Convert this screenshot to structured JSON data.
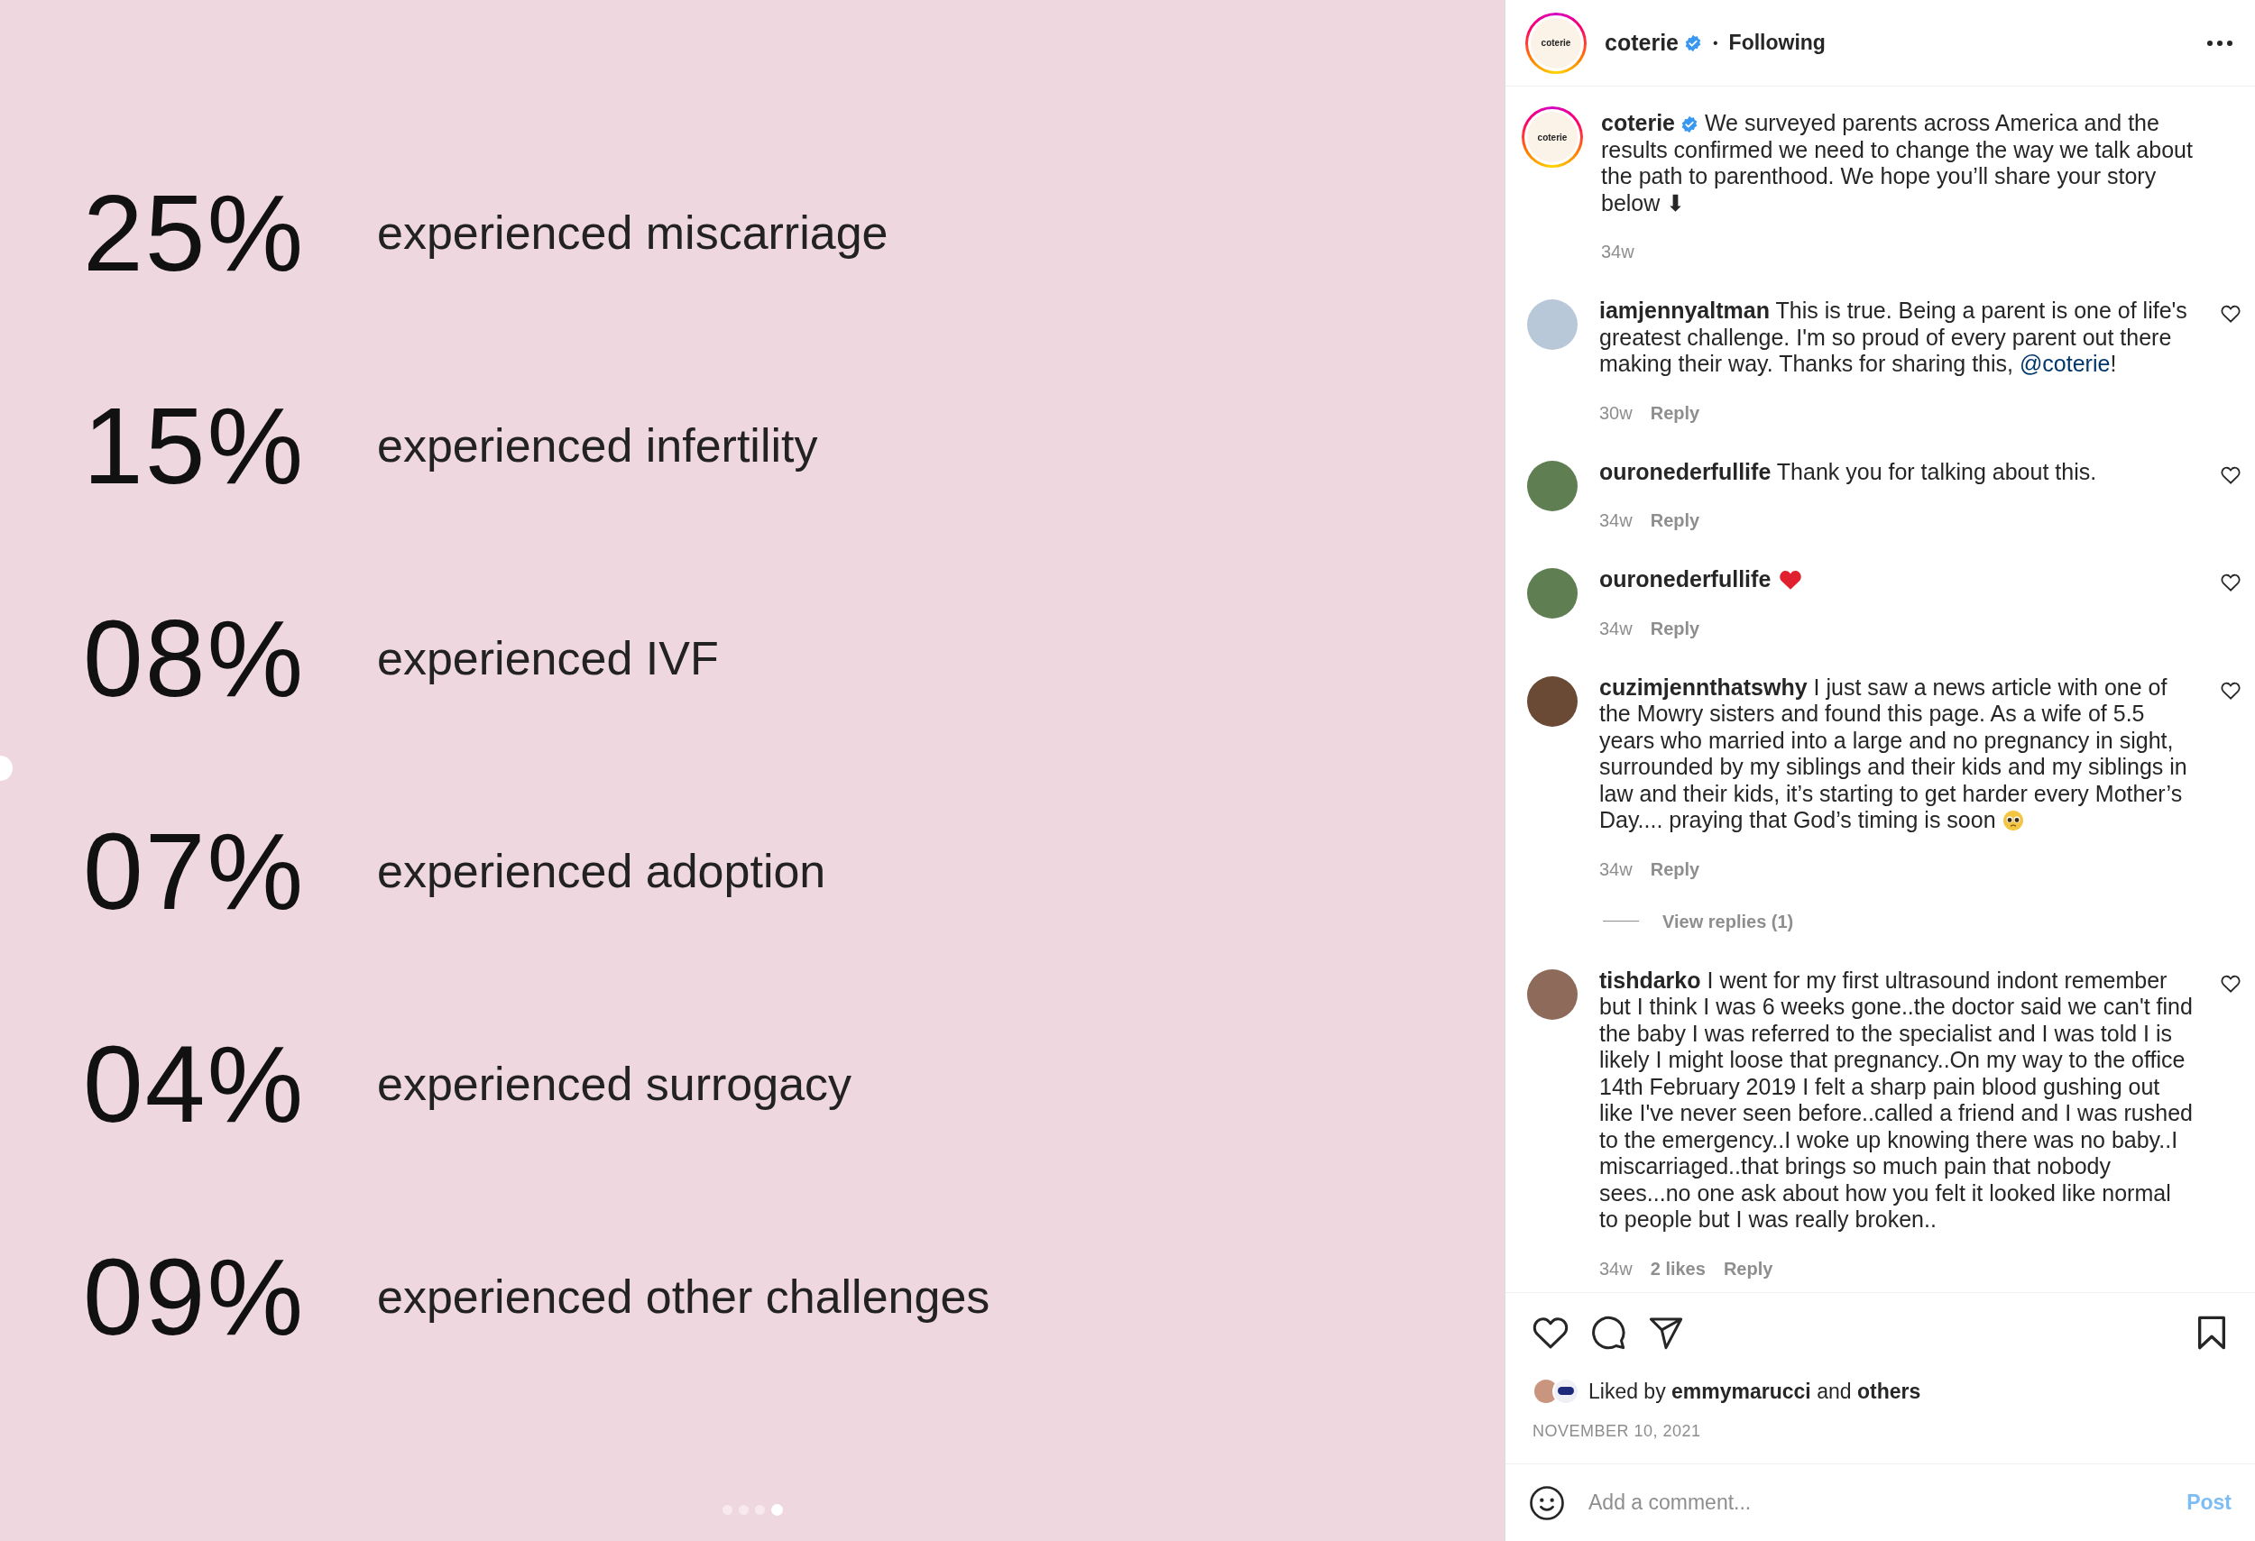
{
  "slide": {
    "stats": [
      {
        "value": "25%",
        "label": "experienced miscarriage"
      },
      {
        "value": "15%",
        "label": "experienced infertility"
      },
      {
        "value": "08%",
        "label": "experienced IVF"
      },
      {
        "value": "07%",
        "label": "experienced adoption"
      },
      {
        "value": "04%",
        "label": "experienced surrogacy"
      },
      {
        "value": "09%",
        "label": "experienced other challenges"
      }
    ],
    "dots": [
      {
        "selected": false
      },
      {
        "selected": false
      },
      {
        "selected": false
      },
      {
        "selected": true
      }
    ]
  },
  "header": {
    "avatar_text": "coterie",
    "username": "coterie",
    "verified": true,
    "separator": "•",
    "follow": "Following"
  },
  "caption": {
    "avatar_text": "coterie",
    "username": "coterie",
    "verified": true,
    "text": "We surveyed parents across America and the results confirmed we need to change the way we talk about the path to parenthood. We hope you’ll share your story below ⬇",
    "time": "34w"
  },
  "comments": [
    {
      "username": "iamjennyaltman",
      "parts": [
        {
          "kind": "text",
          "text": "This is true. Being a parent is one of life's greatest challenge. I'm so proud of every parent out there making their way. Thanks for sharing this, "
        },
        {
          "kind": "mention",
          "text": "@coterie"
        },
        {
          "kind": "text",
          "text": "!"
        }
      ],
      "time": "30w",
      "reply": "Reply",
      "liked": false
    },
    {
      "username": "ouronederfullife",
      "parts": [
        {
          "kind": "text",
          "text": "Thank you for talking about this."
        }
      ],
      "time": "34w",
      "reply": "Reply",
      "liked": false
    },
    {
      "username": "ouronederfullife",
      "parts": [
        {
          "kind": "heart"
        }
      ],
      "time": "34w",
      "reply": "Reply",
      "liked": false
    },
    {
      "username": "cuzimjennthatswhy",
      "parts": [
        {
          "kind": "text",
          "text": "I just saw a news article with one of the Mowry sisters and found this page. As a wife of 5.5 years who married into a large and no pregnancy in sight, surrounded by my siblings and their kids and my siblings in law and their kids, it’s starting to get harder every Mother’s Day.... praying that God’s timing is soon "
        },
        {
          "kind": "pleading"
        }
      ],
      "time": "34w",
      "reply": "Reply",
      "liked": false,
      "view_replies": "View replies (1)"
    },
    {
      "username": "tishdarko",
      "parts": [
        {
          "kind": "text",
          "text": "I went for my first ultrasound indont remember but I think I was 6 weeks gone..the doctor said we can't find the baby I was referred to the specialist and I was told I is likely I might loose that pregnancy..On my way to the office 14th February 2019 I felt a sharp pain blood gushing out like I've never seen before..called a friend and I was rushed to the emergency..I woke up knowing there was no baby..I miscarriaged..that brings so much pain that nobody sees...no one ask about how you felt it looked like normal to people but I was really broken.."
        }
      ],
      "time": "34w",
      "likes": "2 likes",
      "reply": "Reply",
      "liked": false
    }
  ],
  "liked_by": "Liked by **emmymarucci** and **others**",
  "date": "NOVEMBER 10, 2021",
  "add_comment": {
    "placeholder": "Add a comment...",
    "post": "Post",
    "post_disabled": true
  }
}
